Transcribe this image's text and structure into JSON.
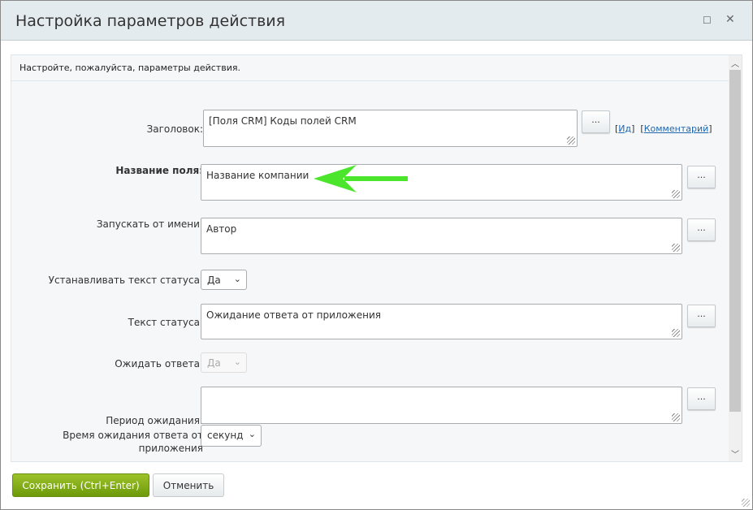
{
  "dialog": {
    "title": "Настройка параметров действия",
    "intro": "Настройте, пожалуйста, параметры действия."
  },
  "fields": {
    "title": {
      "label": "Заголовок:",
      "value": "[Поля CRM] Коды полей CRM",
      "link_id": "Ид",
      "link_comment": "Комментарий"
    },
    "field_name": {
      "label": "Название поля:",
      "value": "Название компании"
    },
    "run_as": {
      "label": "Запускать от имени:",
      "value": "Автор"
    },
    "set_status": {
      "label": "Устанавливать текст статуса:",
      "value": "Да"
    },
    "status_text": {
      "label": "Текст статуса:",
      "value": "Ожидание ответа от приложения"
    },
    "wait_response": {
      "label": "Ожидать ответа:",
      "value": "Да"
    },
    "wait_period": {
      "label": "Период ожидания:",
      "value": ""
    },
    "wait_time": {
      "label_line1": "Время ожидания ответа от",
      "label_line2": "приложения",
      "unit": "секунд"
    }
  },
  "dots_label": "...",
  "footer": {
    "save": "Сохранить (Ctrl+Enter)",
    "cancel": "Отменить"
  },
  "colors": {
    "accent": "#7aa614",
    "arrow": "#4be52c"
  }
}
